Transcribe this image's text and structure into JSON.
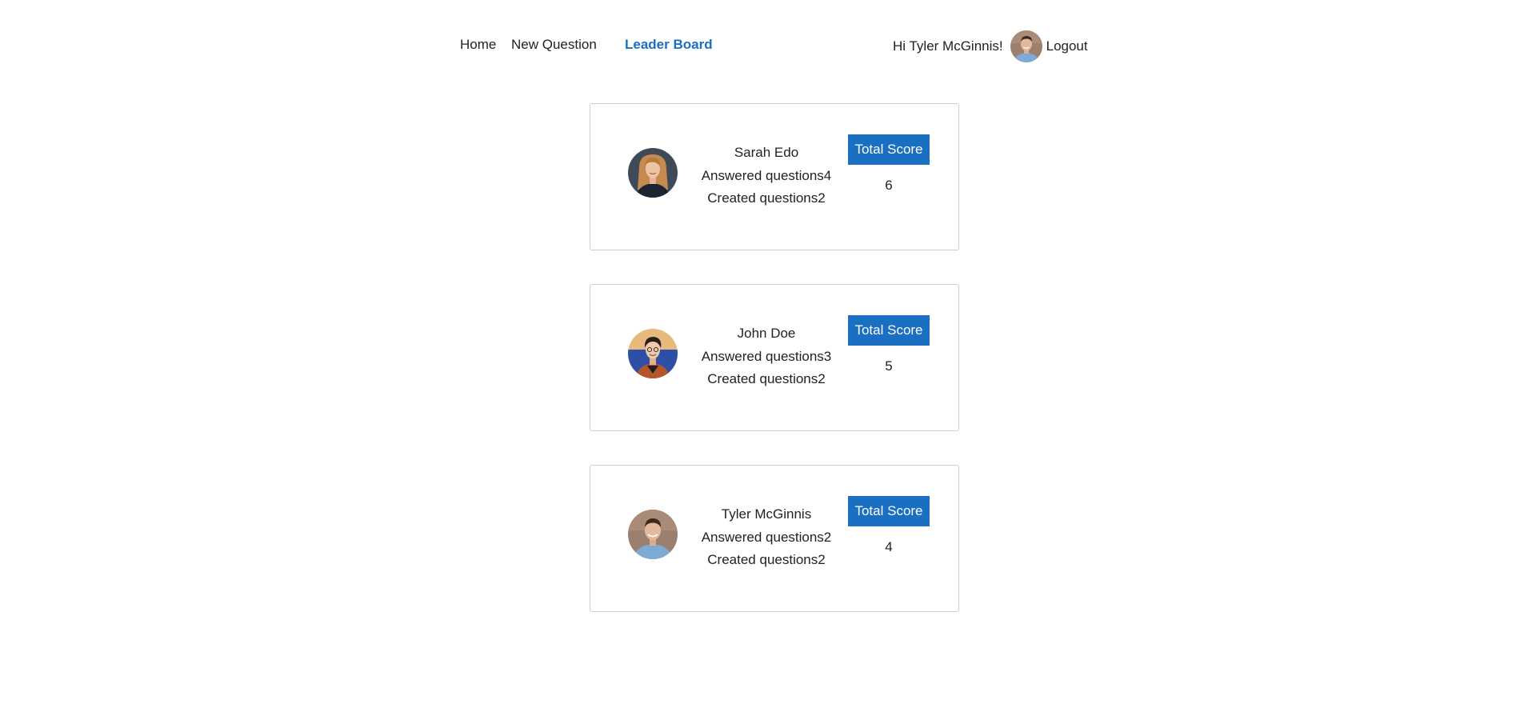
{
  "nav": {
    "home_label": "Home",
    "new_question_label": "New Question",
    "leaderboard_label": "Leader Board",
    "greeting": "Hi Tyler McGinnis!",
    "logout_label": "Logout",
    "active_color": "#1b6fc2"
  },
  "leaderboard": [
    {
      "name": "Sarah Edo",
      "answered": "Answered questions4",
      "created": "Created questions2",
      "score_label": "Total Score",
      "score": "6"
    },
    {
      "name": "John Doe",
      "answered": "Answered questions3",
      "created": "Created questions2",
      "score_label": "Total Score",
      "score": "5"
    },
    {
      "name": "Tyler McGinnis",
      "answered": "Answered questions2",
      "created": "Created questions2",
      "score_label": "Total Score",
      "score": "4"
    }
  ],
  "colors": {
    "accent": "#1b6fc2",
    "card_border": "#cfcfcf"
  }
}
